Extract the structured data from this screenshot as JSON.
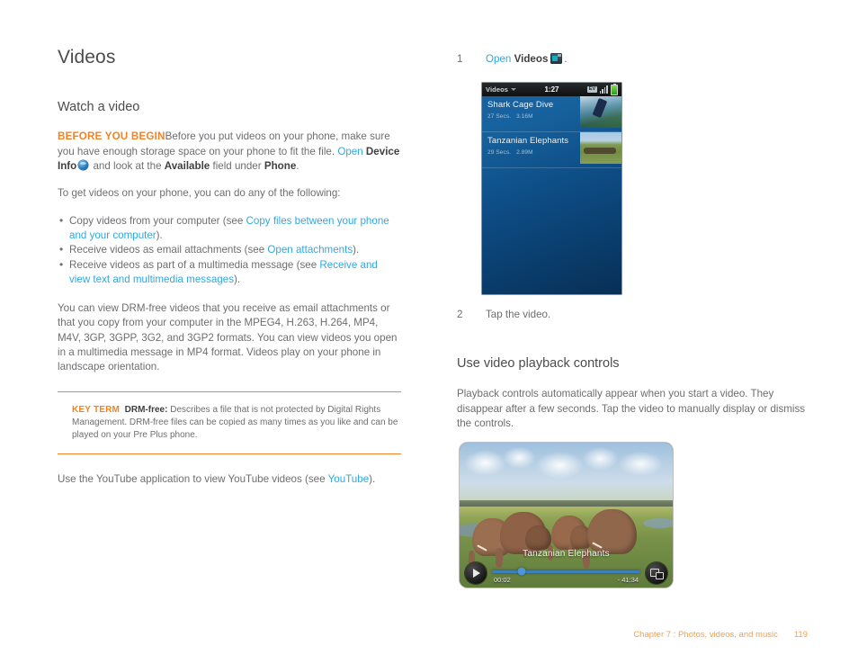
{
  "left": {
    "title": "Videos",
    "section_heading": "Watch a video",
    "before_you_begin": {
      "label": "BEFORE YOU BEGIN",
      "text_1": "Before you put videos on your phone, make sure you have enough storage space on your phone to fit the file. ",
      "link_open": "Open",
      "bold_device": " Device Info",
      "icon": "device-info-icon",
      "text_2": " and look at the ",
      "bold_available": "Available",
      "text_3": " field under ",
      "bold_phone": "Phone",
      "text_4": "."
    },
    "intro": "To get videos on your phone, you can do any of the following:",
    "bullets": [
      {
        "pre": "Copy videos from your computer (see ",
        "link": "Copy files between your phone and your computer",
        "post": ")."
      },
      {
        "pre": "Receive videos as email attachments (see ",
        "link": "Open attachments",
        "post": ")."
      },
      {
        "pre": "Receive videos as part of a multimedia message (see ",
        "link": "Receive and view text and multimedia messages",
        "post": ")."
      }
    ],
    "formats_paragraph": "You can view DRM-free videos that you receive as email attachments or that you copy from your computer in the MPEG4, H.263, H.264, MP4, M4V, 3GP, 3GPP, 3G2, and 3GP2 formats. You can view videos you open in a multimedia message in MP4 format. Videos play on your phone in landscape orientation.",
    "key_term": {
      "label": "KEY TERM",
      "term": "DRM-free:",
      "definition": " Describes a file that is not protected by Digital Rights Management. DRM-free files can be copied as many times as you like and can be played on your Pre Plus phone."
    },
    "youtube_paragraph": {
      "pre": "Use the YouTube application to view YouTube videos (see ",
      "link": "YouTube",
      "post": ")."
    }
  },
  "right": {
    "step1": {
      "number": "1",
      "link_open": "Open",
      "bold_videos": "Videos",
      "icon": "videos-app-icon",
      "period": "."
    },
    "step2": {
      "number": "2",
      "text": "Tap the video."
    },
    "playback_heading": "Use video playback controls",
    "playback_paragraph": "Playback controls automatically appear when you start a video. They disappear after a few seconds. Tap the video to manually display or dismiss the controls."
  },
  "phone_screenshot": {
    "status_bar": {
      "app_name": "Videos",
      "time": "1:27",
      "network_badge": "EV",
      "signal_icon": "signal-bars-icon",
      "battery_icon": "battery-icon"
    },
    "videos": [
      {
        "title": "Shark Cage Dive",
        "duration": "27 Secs.",
        "size": "3.16M",
        "thumbnail": "shark-cage-dive-thumbnail"
      },
      {
        "title": "Tanzanian Elephants",
        "duration": "29 Secs.",
        "size": "2.89M",
        "thumbnail": "tanzanian-elephants-thumbnail"
      }
    ]
  },
  "player_screenshot": {
    "caption": "Tanzanian Elephants",
    "elapsed": "00:02",
    "remaining": "- 41:34",
    "play_icon": "play-icon",
    "fullscreen_icon": "fullscreen-toggle-icon",
    "progress_percent": 20
  },
  "footer": {
    "chapter": "Chapter 7 :  Photos, videos, and music",
    "page_number": "119"
  },
  "colors": {
    "accent_orange": "#f58220",
    "link_blue": "#31a8e0",
    "body_gray": "#6d6e71",
    "footer_orange": "#f5a04a"
  }
}
